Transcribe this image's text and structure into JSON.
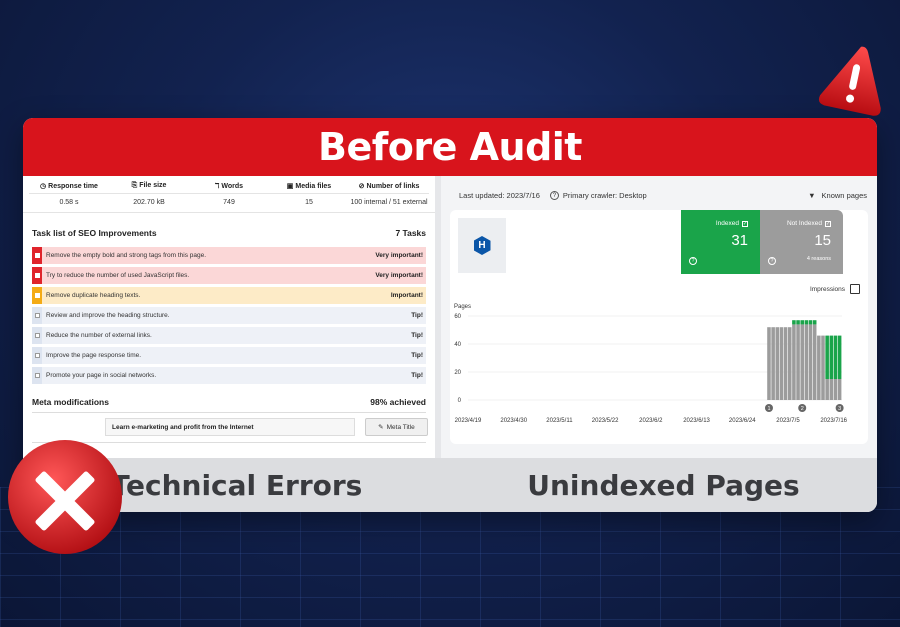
{
  "banner": {
    "title": "Before Audit"
  },
  "metrics": [
    {
      "icon": "clock-icon",
      "glyph": "◷",
      "label": "Response time",
      "value": "0.58 s"
    },
    {
      "icon": "file-icon",
      "glyph": "⎘",
      "label": "File size",
      "value": "202.70 kB"
    },
    {
      "icon": "text-icon",
      "glyph": "ℸ",
      "label": "Words",
      "value": "749"
    },
    {
      "icon": "image-icon",
      "glyph": "▣",
      "label": "Media files",
      "value": "15"
    },
    {
      "icon": "link-icon",
      "glyph": "⊘",
      "label": "Number of links",
      "value": "100 internal / 51 external"
    }
  ],
  "tasks": {
    "title": "Task list of SEO Improvements",
    "count": "7 Tasks",
    "items": [
      {
        "text": "Remove the empty bold and strong tags from this page.",
        "level": "Very important!",
        "severity": "red"
      },
      {
        "text": "Try to reduce the number of used JavaScript files.",
        "level": "Very important!",
        "severity": "red"
      },
      {
        "text": "Remove duplicate heading texts.",
        "level": "Important!",
        "severity": "yellow"
      },
      {
        "text": "Review and improve the heading structure.",
        "level": "Tip!",
        "severity": "blue"
      },
      {
        "text": "Reduce the number of external links.",
        "level": "Tip!",
        "severity": "blue"
      },
      {
        "text": "Improve the page response time.",
        "level": "Tip!",
        "severity": "blue"
      },
      {
        "text": "Promote your page in social networks.",
        "level": "Tip!",
        "severity": "blue"
      }
    ]
  },
  "meta": {
    "title": "Meta modifications",
    "achieved": "98% achieved",
    "field_value": "Learn e-marketing and profit from the Internet",
    "button_label": "Meta Title"
  },
  "gsc": {
    "last_updated": "Last updated: 2023/7/16",
    "crawler": "Primary crawler: Desktop",
    "known_pages": "Known pages",
    "logo_letter": "H",
    "indexed_label": "Indexed",
    "indexed_value": "31",
    "not_indexed_label": "Not Indexed",
    "not_indexed_value": "15",
    "not_indexed_sub": "4 reasons",
    "impressions_label": "Impressions",
    "colors": {
      "indexed": "#1aa44a",
      "not_indexed": "#9c9c9c"
    }
  },
  "chart_data": {
    "type": "bar",
    "ylabel": "Pages",
    "ylim": [
      0,
      60
    ],
    "yticks": [
      0,
      20,
      40,
      60
    ],
    "xticks": [
      "2023/4/19",
      "2023/4/30",
      "2023/5/11",
      "2023/5/22",
      "2023/6/2",
      "2023/6/13",
      "2023/6/24",
      "2023/7/5",
      "2023/7/16"
    ],
    "x_start": "2023/4/19",
    "x_end": "2023/7/18",
    "series": [
      {
        "dates": [
          "2023/6/30",
          "2023/7/1",
          "2023/7/2",
          "2023/7/3",
          "2023/7/4",
          "2023/7/5",
          "2023/7/6",
          "2023/7/7",
          "2023/7/8",
          "2023/7/9",
          "2023/7/10",
          "2023/7/11",
          "2023/7/12",
          "2023/7/13",
          "2023/7/14",
          "2023/7/15",
          "2023/7/16",
          "2023/7/17"
        ],
        "values": [
          52,
          52,
          52,
          52,
          52,
          52,
          54,
          54,
          54,
          54,
          54,
          54,
          46,
          46,
          15,
          15,
          15,
          15
        ]
      },
      {
        "dates": [
          "2023/6/30",
          "2023/7/1",
          "2023/7/2",
          "2023/7/3",
          "2023/7/4",
          "2023/7/5",
          "2023/7/6",
          "2023/7/7",
          "2023/7/8",
          "2023/7/9",
          "2023/7/10",
          "2023/7/11",
          "2023/7/12",
          "2023/7/13",
          "2023/7/14",
          "2023/7/15",
          "2023/7/16",
          "2023/7/17"
        ],
        "values": [
          0,
          0,
          0,
          0,
          0,
          0,
          3,
          3,
          3,
          3,
          3,
          3,
          0,
          0,
          31,
          31,
          31,
          31
        ]
      }
    ],
    "annotations": [
      "1",
      "2",
      "3"
    ]
  },
  "bottom": {
    "left": "Technical Errors",
    "right": "Unindexed Pages"
  }
}
